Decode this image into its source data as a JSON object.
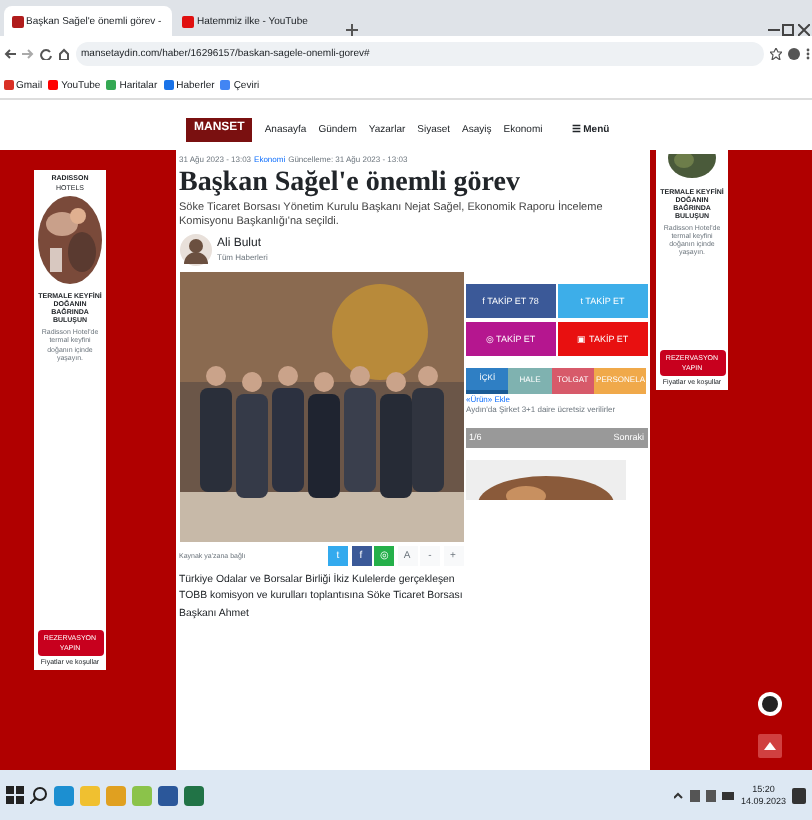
{
  "browser": {
    "tabs": [
      {
        "title": "Başkan Sağel'e önemli görev -",
        "selected": true,
        "color": "#b01c1c"
      },
      {
        "title": "Hatemmiz ilke - YouTube",
        "selected": false,
        "color": "#e01010"
      }
    ],
    "address": "mansetaydin.com/haber/16296157/baskan-sagele-onemli-gorev#",
    "bookmarks": [
      "Gmail",
      "YouTube",
      "Haritalar",
      "Haberler",
      "Çeviri"
    ]
  },
  "site": {
    "logo": "MANSET",
    "nav": [
      "Anasayfa",
      "Gündem",
      "Yazarlar",
      "Siyaset",
      "Asayiş",
      "Ekonomi"
    ],
    "menu": "☰ Menü"
  },
  "ads": [
    {
      "brand": "RADISSON",
      "brand_sub": "HOTELS",
      "headline": "TERMALE KEYFİNİ DOĞANIN BAĞRINDA BULUŞUN",
      "body": "Radisson Hotel'de termal keyfini doğanın içinde yaşayın.",
      "button": "REZERVASYON YAPIN",
      "note": "Fiyatlar ve koşullar"
    },
    {
      "headline": "TERMALE KEYFİNİ DOĞANIN BAĞRINDA BULUŞUN",
      "body": "Radisson Hotel'de termal keyfini doğanın içinde yaşayın.",
      "button": "REZERVASYON YAPIN",
      "note": "Fiyatlar ve koşullar"
    }
  ],
  "article": {
    "date": "31 Ağu 2023 - 13:03",
    "category": "Ekonomi",
    "updated": "Güncelleme: 31 Ağu 2023 - 13:03",
    "title": "Başkan Sağel'e önemli görev",
    "summary": "Söke Ticaret Borsası Yönetim Kurulu Başkanı Nejat Sağel, Ekonomik Raporu İnceleme Komisyonu Başkanlığı'na seçildi.",
    "author": {
      "name": "Ali Bulut",
      "link": "Tüm Haberleri"
    },
    "caption": "Kaynak ya'zana bağlı ",
    "share_small": [
      {
        "label": "t",
        "color": "#33aaee"
      },
      {
        "label": "f",
        "color": "#3b5998"
      },
      {
        "label": "◎",
        "color": "#25b04a"
      }
    ],
    "font_buttons": [
      "A",
      "-",
      "+"
    ],
    "body": "Türkiye Odalar ve Borsalar Birliği İkiz Kulelerde gerçekleşen TOBB komisyon ve kurulları toplantısına Söke Ticaret Borsası Başkanı Ahmet"
  },
  "sidebar": {
    "follow": [
      {
        "label": "f",
        "text": "TAKİP ET 78",
        "color": "#3b5998"
      },
      {
        "label": "t",
        "text": "TAKİP ET",
        "color": "#3daee9"
      },
      {
        "label": "◎",
        "text": "TAKİP ET",
        "color": "#b5168f"
      },
      {
        "label": "▣",
        "text": "TAKİP ET",
        "color": "#e81010"
      }
    ],
    "tabs": [
      {
        "label": "İÇKİ",
        "color": "#2f7fc4",
        "selected": true
      },
      {
        "label": "HALE",
        "color": "#7fb2b0",
        "selected": false
      },
      {
        "label": "TOLGAT",
        "color": "#d75a6a",
        "selected": false
      },
      {
        "label": "PERSONELA",
        "color": "#f0a94a",
        "selected": false
      }
    ],
    "item_lead": "«Ürün» Ekle",
    "item_text": "Aydın'da Şirket 3+1 daire ücretsiz verilirler",
    "pager": {
      "page": "1/6",
      "next": "Sonraki"
    }
  },
  "taskbar": {
    "time": "15:20",
    "date": "14.09.2023"
  }
}
